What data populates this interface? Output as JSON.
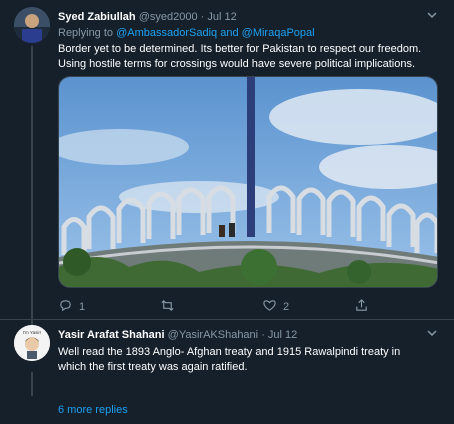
{
  "tweet1": {
    "display_name": "Syed Zabiullah",
    "handle": "@syed2000",
    "separator": "·",
    "date": "Jul 12",
    "replying_prefix": "Replying to",
    "mention1": "@AmbassadorSadiq",
    "mention_joiner": "and",
    "mention2": "@MiraqaPopal",
    "text_line1": "Border yet to be determined. Its better for Pakistan to respect our freedom.",
    "text_line2": "Using hostile terms for crossings would have severe political implications.",
    "reply_count": "1",
    "retweet_count": "",
    "like_count": "2"
  },
  "tweet2": {
    "display_name": "Yasir Arafat Shahani",
    "handle": "@YasirAKShahani",
    "separator": "·",
    "date": "Jul 12",
    "avatar_caption": "I'm Yasir!",
    "text_line1": "Well read the 1893 Anglo- Afghan treaty and 1915 Rawalpindi treaty in",
    "text_line2": "which the first treaty was again ratified."
  },
  "thread": {
    "more_replies": "6 more replies"
  },
  "icons": [
    "chevron-down-icon",
    "reply-icon",
    "retweet-icon",
    "like-icon",
    "share-icon"
  ],
  "colors": {
    "background": "#15202b",
    "accent": "#1da1f2",
    "muted": "#8899a6",
    "border": "#38444d"
  }
}
